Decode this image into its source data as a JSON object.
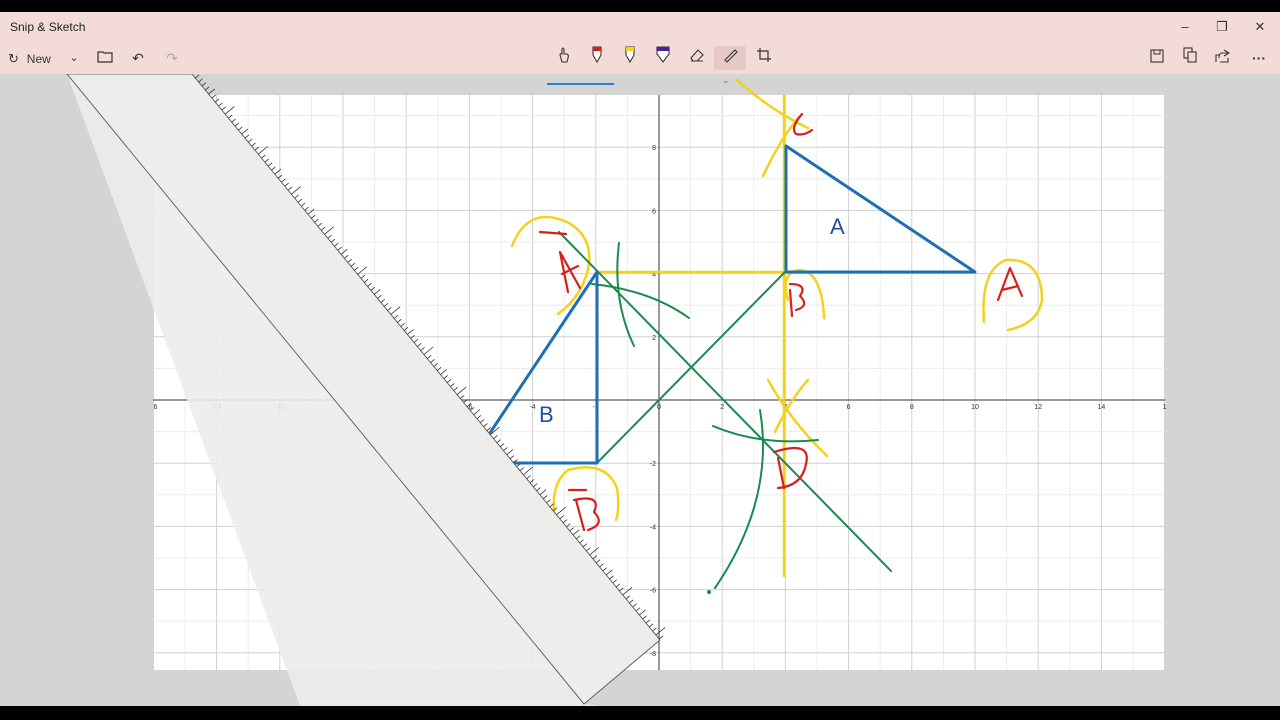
{
  "app": {
    "title": "Snip & Sketch"
  },
  "window_controls": {
    "minimize": "–",
    "restore": "❐",
    "close": "✕"
  },
  "toolbar": {
    "new_label": "New",
    "new_icon": "snip-icon",
    "more_label": "···",
    "tools": [
      "touch-writing",
      "ballpoint-pen",
      "pencil",
      "highlighter",
      "eraser",
      "ruler",
      "crop"
    ],
    "selected_tool": "ruler"
  },
  "graph": {
    "x_ticks": [
      "6",
      "-14",
      "-12",
      "-10",
      "-8",
      "-6",
      "-4",
      "-2",
      "0",
      "2",
      "4",
      "6",
      "8",
      "10",
      "12",
      "14",
      "1"
    ],
    "y_ticks": [
      "8",
      "6",
      "4",
      "2",
      "-2",
      "-4",
      "-6",
      "-8"
    ],
    "shape_labels": {
      "a": "A",
      "b": "B"
    },
    "handwritten": {
      "c_top": "C",
      "a_left": "A",
      "b_center": "B",
      "a_right": "A",
      "b_lower": "B",
      "d_lower": "D",
      "c_faint": "C"
    }
  },
  "colors": {
    "triangle": "#1c6fb5",
    "construction_yellow": "#f2d21b",
    "construction_green": "#1a8a4f",
    "annotation_red": "#d6201c",
    "title_bg": "#f3dcd8",
    "ruler": "#eeeeec"
  }
}
